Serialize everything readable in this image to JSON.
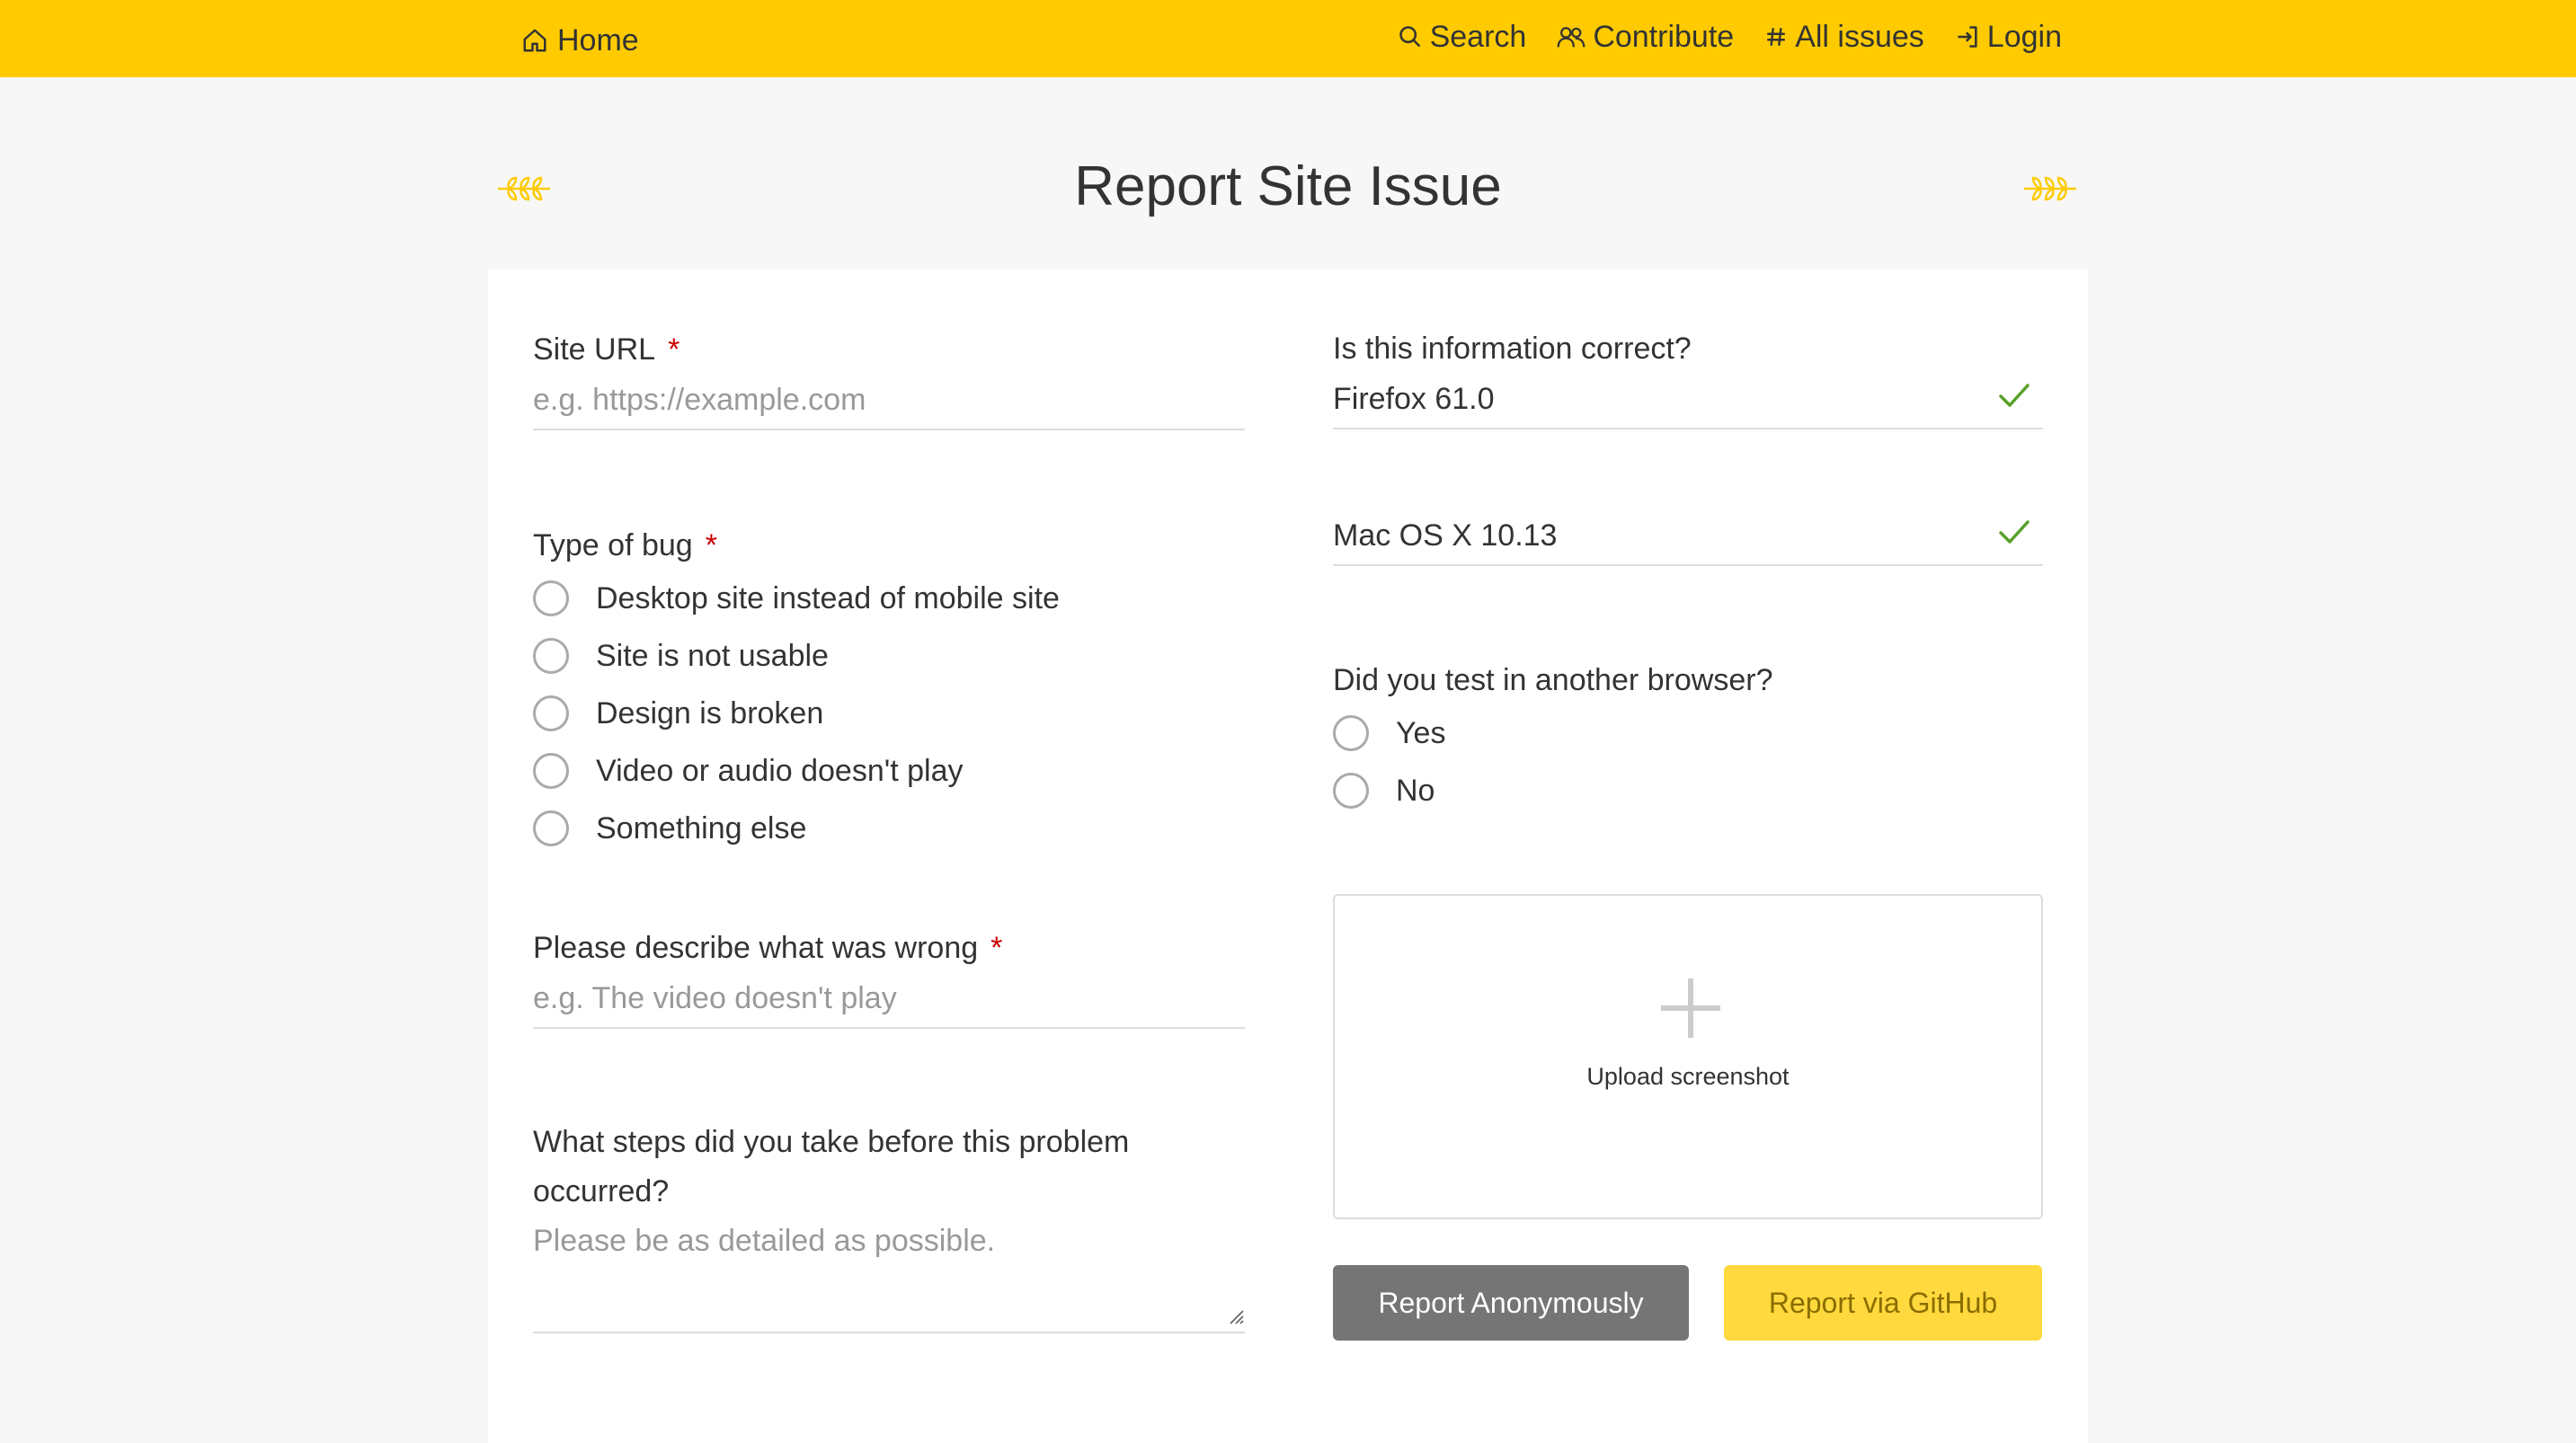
{
  "header": {
    "home_label": "Home",
    "nav": [
      {
        "label": "Search",
        "icon": "search-icon"
      },
      {
        "label": "Contribute",
        "icon": "people-icon"
      },
      {
        "label": "All issues",
        "icon": "hash-icon"
      },
      {
        "label": "Login",
        "icon": "login-icon"
      }
    ]
  },
  "page": {
    "title": "Report Site Issue"
  },
  "form": {
    "site_url": {
      "label": "Site URL",
      "required_mark": "*",
      "placeholder": "e.g. https://example.com"
    },
    "bug_type": {
      "label": "Type of bug",
      "required_mark": "*",
      "options": [
        "Desktop site instead of mobile site",
        "Site is not usable",
        "Design is broken",
        "Video or audio doesn't play",
        "Something else"
      ]
    },
    "description": {
      "label": "Please describe what was wrong",
      "required_mark": "*",
      "placeholder": "e.g. The video doesn't play"
    },
    "steps": {
      "label": "What steps did you take before this problem occurred?",
      "placeholder": "Please be as detailed as possible."
    },
    "info": {
      "label": "Is this information correct?",
      "browser": "Firefox 61.0",
      "os": "Mac OS X 10.13"
    },
    "other_browser": {
      "label": "Did you test in another browser?",
      "options": [
        "Yes",
        "No"
      ]
    },
    "upload": {
      "label": "Upload screenshot"
    },
    "buttons": {
      "anonymous": "Report Anonymously",
      "github": "Report via GitHub"
    }
  },
  "colors": {
    "header_bg": "#ffcb00",
    "accent": "#ffd93d",
    "check": "#5aa02c",
    "required": "#cc0000",
    "anon_button": "#757575"
  }
}
